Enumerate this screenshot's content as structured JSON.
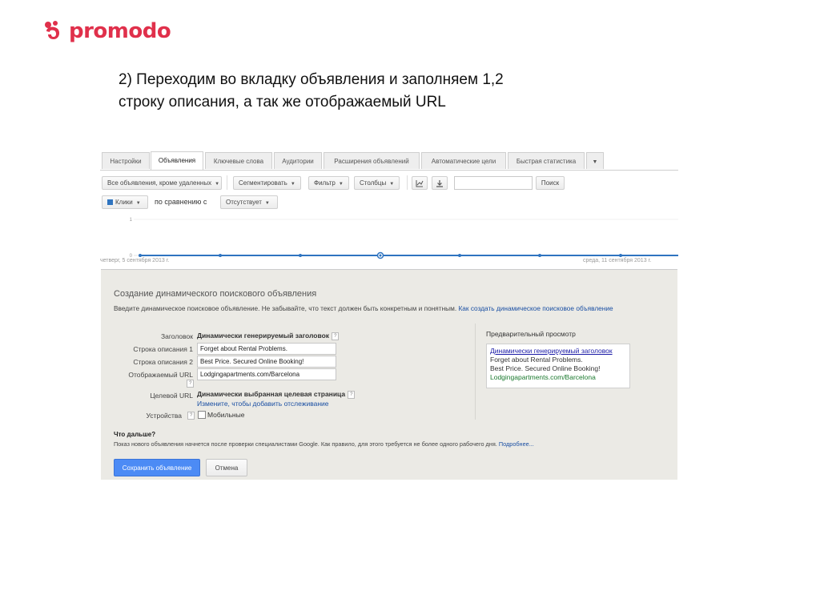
{
  "logo": {
    "text": "promodo",
    "brand_color": "#e0304b"
  },
  "slide": {
    "line1": "2) Переходим во вкладку объявления и заполняем 1,2",
    "line2": "строку описания, а так же отображаемый URL"
  },
  "tabs": [
    {
      "label": "Настройки"
    },
    {
      "label": "Объявления",
      "active": true
    },
    {
      "label": "Ключевые слова"
    },
    {
      "label": "Аудитории"
    },
    {
      "label": "Расширения объявлений"
    },
    {
      "label": "Автоматические цели"
    },
    {
      "label": "Быстрая статистика"
    }
  ],
  "toolbar": {
    "filter_ads": "Все объявления, кроме удаленных",
    "segment": "Сегментировать",
    "filter": "Фильтр",
    "columns": "Столбцы",
    "search_button": "Поиск"
  },
  "compare": {
    "metric": "Клики",
    "label": "по сравнению с",
    "absent": "Отсутствует"
  },
  "chart": {
    "y_tick_top": "1",
    "y_tick_bottom": "0",
    "start_date": "четверг, 5 сентября 2013 г.",
    "end_date": "среда, 11 сентября 2013 г.",
    "line_color": "#2f74c0"
  },
  "form": {
    "title": "Создание динамического поискового объявления",
    "description": "Введите динамическое поисковое объявление. Не забывайте, что текст должен быть конкретным и понятным.",
    "description_link": "Как создать динамическое поисковое объявление",
    "headline_label": "Заголовок",
    "headline_value": "Динамически генерируемый заголовок",
    "desc1_label": "Строка описания 1",
    "desc1_value": "Forget about Rental Problems.",
    "desc2_label": "Строка описания 2",
    "desc2_value": "Best Price. Secured Online Booking!",
    "display_url_label": "Отображаемый URL",
    "display_url_value": "Lodgingapartments.com/Barcelona",
    "target_url_label": "Целевой URL",
    "target_url_value": "Динамически выбранная целевая страница",
    "target_url_link": "Измените, чтобы добавить отслеживание",
    "devices_label": "Устройства",
    "mobile_label": "Мобильные",
    "help_glyph": "?"
  },
  "preview": {
    "title": "Предварительный просмотр",
    "headline": "Динамически генерируемый заголовок",
    "line1": "Forget about Rental Problems.",
    "line2": "Best Price. Secured Online Booking!",
    "url": "Lodgingapartments.com/Barcelona"
  },
  "whats_next": {
    "title": "Что дальше?",
    "text": "Показ нового объявления начнется после проверки специалистами Google. Как правило, для этого требуется не более одного рабочего дня.",
    "link": "Подробнее..."
  },
  "buttons": {
    "save": "Сохранить объявление",
    "cancel": "Отмена"
  }
}
